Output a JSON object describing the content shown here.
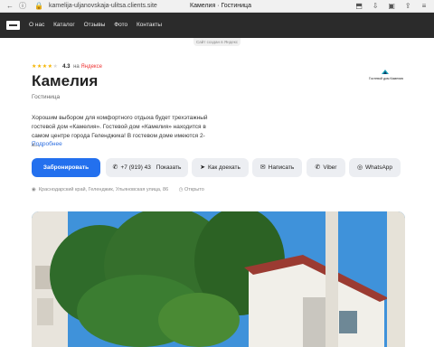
{
  "browser": {
    "url": "kamelija-uljanovskaja-ulitsa.clients.site",
    "tab_title": "Камелия · Гостиница"
  },
  "nav": {
    "items": [
      "О нас",
      "Каталог",
      "Отзывы",
      "Фото",
      "Контакты"
    ]
  },
  "created_badge": "Сайт создан в Яндекс",
  "rating": {
    "value": "4.3",
    "on": "на",
    "source": "Яндексе",
    "stars": 4
  },
  "title": "Камелия",
  "subtitle": "Гостиница",
  "hotel_logo_caption": "Гостевой дом Камелия",
  "description": "Хорошим выбором для комфортного отдыха будет трехэтажный гостевой дом «Камелия». Гостевой дом «Камелия» находится в самом центре города Геленджика! В гостевом доме имеются 2-х...",
  "more_link": "Подробнее",
  "buttons": {
    "book": "Забронировать",
    "phone": "+7 (919) 43",
    "phone_show": "Показать",
    "route": "Как доехать",
    "write": "Написать",
    "viber": "Viber",
    "whatsapp": "WhatsApp"
  },
  "address": "Краснодарский край, Геленджик, Ульяновская улица, 86",
  "status": "Открыто",
  "colors": {
    "accent": "#2370ee",
    "nav_bg": "#2b2b2b",
    "star": "#f5b400"
  }
}
